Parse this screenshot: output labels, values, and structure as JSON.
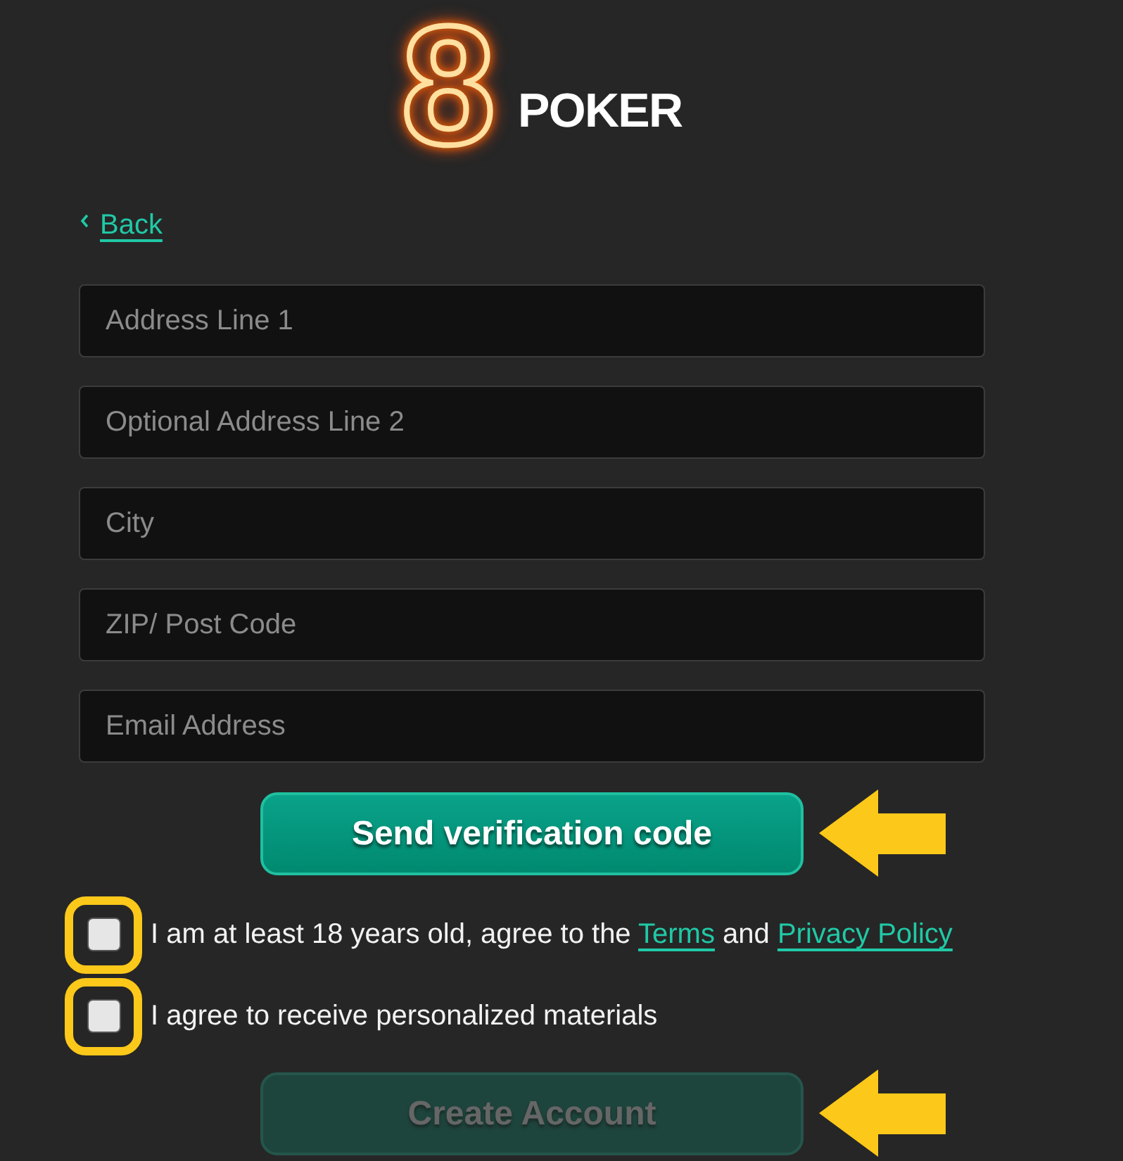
{
  "logo": {
    "mark": "8",
    "wordmark": "POKER"
  },
  "back_link": {
    "label": "Back"
  },
  "fields": [
    {
      "placeholder": "Address Line 1"
    },
    {
      "placeholder": "Optional Address Line 2"
    },
    {
      "placeholder": "City"
    },
    {
      "placeholder": "ZIP/ Post Code"
    },
    {
      "placeholder": "Email Address"
    }
  ],
  "send_button": {
    "label": "Send verification code",
    "disabled": false,
    "callout": true
  },
  "consents": [
    {
      "checked": false,
      "highlighted": true,
      "parts": [
        {
          "kind": "text",
          "text": "I am at least 18 years old, agree to the "
        },
        {
          "kind": "link",
          "text": "Terms"
        },
        {
          "kind": "text",
          "text": " and "
        },
        {
          "kind": "link",
          "text": "Privacy Policy"
        }
      ]
    },
    {
      "checked": false,
      "highlighted": true,
      "parts": [
        {
          "kind": "text",
          "text": "I agree to receive personalized materials"
        }
      ]
    }
  ],
  "create_button": {
    "label": "Create Account",
    "disabled": true,
    "callout": true
  }
}
